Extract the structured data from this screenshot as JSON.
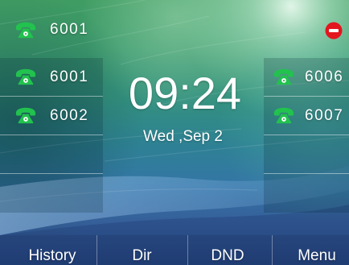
{
  "status_bar": {
    "account_label": "6001",
    "account_icon": "phone-icon",
    "status_icon": "dnd-icon"
  },
  "line_keys": {
    "left": [
      {
        "label": "6001",
        "icon": "phone-icon"
      },
      {
        "label": "6002",
        "icon": "phone-icon"
      }
    ],
    "right": [
      {
        "label": "6006",
        "icon": "phone-icon"
      },
      {
        "label": "6007",
        "icon": "phone-icon"
      }
    ]
  },
  "clock": {
    "time": "09:24",
    "date": "Wed ,Sep 2"
  },
  "softkeys": [
    {
      "label": "History"
    },
    {
      "label": "Dir"
    },
    {
      "label": "DND"
    },
    {
      "label": "Menu"
    }
  ],
  "colors": {
    "line_icon": "#22c24e",
    "status_icon": "#e3151f",
    "text": "#ffffff"
  }
}
